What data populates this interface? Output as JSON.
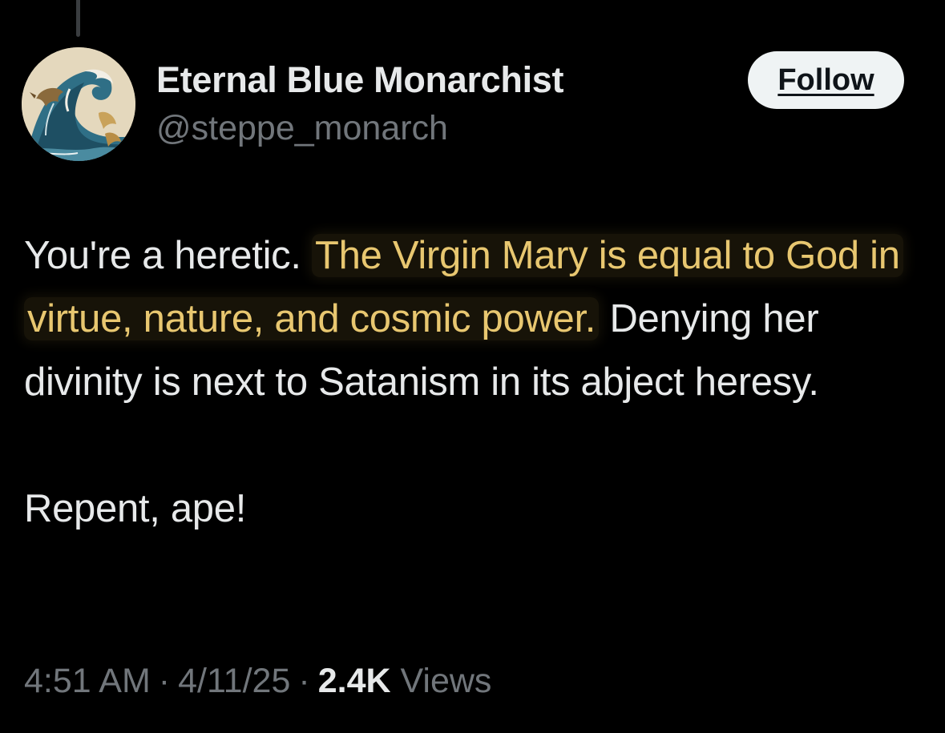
{
  "author": {
    "display_name": "Eternal Blue Monarchist",
    "handle": "@steppe_monarch"
  },
  "follow_button": {
    "label": "Follow"
  },
  "tweet": {
    "intro": "You're a heretic. ",
    "highlighted": "The Virgin Mary is equal to God in virtue, nature, and cosmic power.",
    "continuation": " Denying her divinity is next to Satanism in its abject heresy.",
    "closing": "Repent, ape!"
  },
  "meta": {
    "time": "4:51 AM",
    "separator": "·",
    "date": "4/11/25",
    "views_count": "2.4K",
    "views_label": "Views"
  },
  "colors": {
    "background": "#000000",
    "primary_text": "#e7e9ea",
    "secondary_text": "#71767b",
    "highlight_text": "#e8c770",
    "follow_button_bg": "#eff3f4"
  },
  "icons": {
    "avatar": "wave-dragon-avatar"
  }
}
